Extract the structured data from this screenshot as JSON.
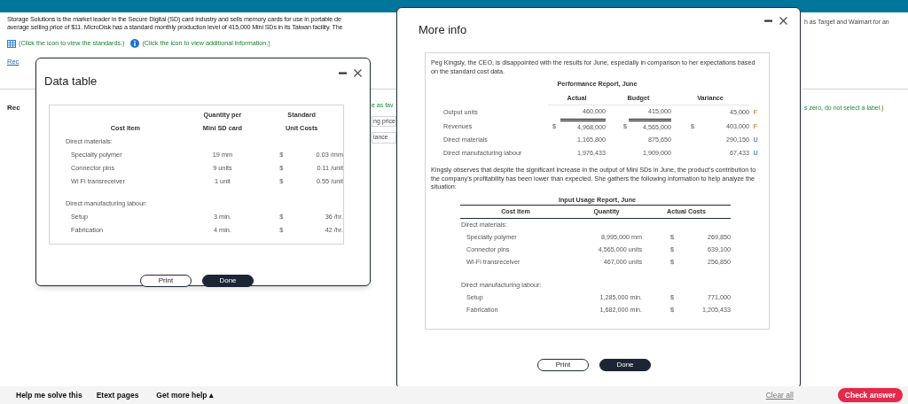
{
  "problem": {
    "lines": [
      "Storage Solutions is the market leader in the Secure Digital (SD) card industry and sells memory cards for use in portable de",
      "average selling price of $11. MicroDisk has a standard monthly production level of 415,000 Mini SDs in its Taiwan facility. The"
    ],
    "standards_link": "(Click the icon to view the standards.)",
    "info_link": "(Click the icon to view additional information.)",
    "requirements_link": "Rec",
    "requirements_heading": "Rec",
    "middle_fragments": [
      {
        "kind": "hint",
        "text": "e as fav"
      },
      {
        "kind": "plain",
        "text": "ng price"
      },
      {
        "kind": "plain",
        "text": "iance"
      }
    ],
    "right_fragments": [
      {
        "kind": "plain",
        "text": "h as Target and Walmart for an"
      },
      {
        "kind": "hint",
        "text": "s zero, do not select a label.)"
      }
    ]
  },
  "data_table": {
    "title": "Data table",
    "header_top": [
      "Quantity per",
      "Standard"
    ],
    "header": [
      "Cost Item",
      "Mini SD card",
      "Unit Costs"
    ],
    "rows": [
      {
        "kind": "section",
        "label": "Direct materials:"
      },
      {
        "kind": "item",
        "label": "Specialty polymer",
        "quantity": "19 mm",
        "currency": "$",
        "cost": "0.03 /mm"
      },
      {
        "kind": "item",
        "label": "Connector pins",
        "quantity": "9 units",
        "currency": "$",
        "cost": "0.11 /unit"
      },
      {
        "kind": "item",
        "label": "Wi Fi transreceiver",
        "quantity": "1 unit",
        "currency": "$",
        "cost": "0.55 /unit"
      },
      {
        "kind": "section",
        "label": "Direct manufacturing labour:"
      },
      {
        "kind": "item",
        "label": "Setup",
        "quantity": "3 min.",
        "currency": "$",
        "cost": "36 /hr."
      },
      {
        "kind": "item",
        "label": "Fabrication",
        "quantity": "4 min.",
        "currency": "$",
        "cost": "42 /hr."
      }
    ],
    "buttons": [
      {
        "kind": "outline",
        "label": "Print"
      },
      {
        "kind": "primary",
        "label": "Done"
      }
    ]
  },
  "more_info": {
    "title": "More info",
    "intro": "Peg Kingsly, the CEO, is disappointed with the results for June, especially in comparison to her expectations based on the standard cost data.",
    "performance": {
      "title": "Performance Report, June",
      "columns": [
        "Actual",
        "Budget",
        "Variance"
      ],
      "rows": [
        {
          "kind": "units",
          "label": "Output units",
          "actual": "460,000",
          "budget": "415,000",
          "variance": "45,000",
          "flag": "F"
        },
        {
          "kind": "money",
          "label": "Revenues",
          "actual_currency": "$",
          "actual": "4,968,000",
          "budget_currency": "$",
          "budget": "4,565,000",
          "variance_currency": "$",
          "variance": "403,000",
          "flag": "F"
        },
        {
          "kind": "money",
          "label": "Direct materials",
          "actual": "1,165,800",
          "budget": "875,650",
          "variance": "290,150",
          "flag": "U"
        },
        {
          "kind": "money",
          "label": "Direct manufacturing labour",
          "actual": "1,976,433",
          "budget": "1,909,000",
          "variance": "67,433",
          "flag": "U"
        }
      ]
    },
    "observation": "Kingsly observes that despite the significant increase in the output of Mini SDs in June, the product's contribution to the company's profitability has been lower than expected. She gathers the following information to help analyze the situation:",
    "usage": {
      "title": "Input Usage Report, June",
      "columns": [
        "Cost Item",
        "Quantity",
        "Actual Costs"
      ],
      "rows": [
        {
          "kind": "section",
          "label": "Direct materials:"
        },
        {
          "kind": "item",
          "label": "Specialty polymer",
          "quantity": "8,995,000 mm",
          "currency": "$",
          "cost": "269,850"
        },
        {
          "kind": "item",
          "label": "Connector pins",
          "quantity": "4,565,000 units",
          "currency": "$",
          "cost": "639,100"
        },
        {
          "kind": "item",
          "label": "Wi-Fi transreceiver",
          "quantity": "467,000 units",
          "currency": "$",
          "cost": "256,850"
        },
        {
          "kind": "section",
          "label": "Direct manufacturing labour:"
        },
        {
          "kind": "item",
          "label": "Setup",
          "quantity": "1,285,000 min.",
          "currency": "$",
          "cost": "771,000"
        },
        {
          "kind": "item",
          "label": "Fabrication",
          "quantity": "1,682,000 min.",
          "currency": "$",
          "cost": "1,205,433"
        }
      ]
    },
    "buttons": [
      {
        "kind": "outline",
        "label": "Print"
      },
      {
        "kind": "primary",
        "label": "Done"
      }
    ]
  },
  "footer": {
    "links": [
      "Help me solve this",
      "Etext pages",
      "Get more help ▴"
    ],
    "clear": "Clear all",
    "check": "Check answer"
  }
}
